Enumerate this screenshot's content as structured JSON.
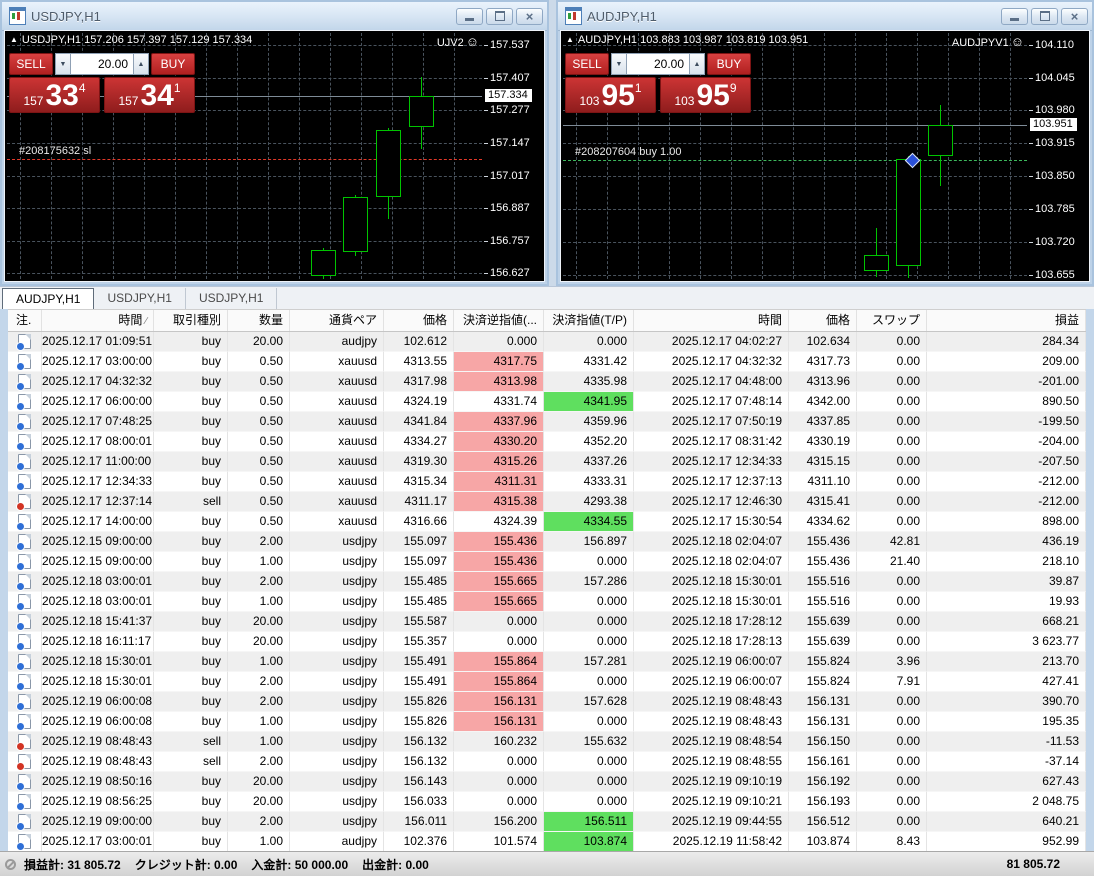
{
  "icons": {
    "triangle_up": "▲",
    "arrow_up": "▲",
    "arrow_down": "▼",
    "smiley": "☺",
    "close": "×",
    "sort_slash": "∕"
  },
  "charts": [
    {
      "window_title": "USDJPY,H1",
      "info_line": "USDJPY,H1 157.206 157.397 157.129 157.334",
      "ea_label": "UJV2",
      "trade_panel": {
        "sell_label": "SELL",
        "buy_label": "BUY",
        "volume": "20.00",
        "sell_price": {
          "small": "157",
          "big": "33",
          "sup": "4"
        },
        "buy_price": {
          "small": "157",
          "big": "34",
          "sup": "1"
        }
      },
      "order_line": {
        "label": "#208175632 sl",
        "price": 157.082,
        "color": "#e23a2a"
      },
      "chart_data": {
        "type": "candlestick",
        "symbol": "USDJPY",
        "timeframe": "H1",
        "ohlc": {
          "open": 157.206,
          "high": 157.397,
          "low": 157.129,
          "close": 157.334
        },
        "current_price": 157.334,
        "price_max": 157.585,
        "price_min": 156.605,
        "y_ticks": [
          157.537,
          157.407,
          157.277,
          157.147,
          157.017,
          156.887,
          156.757,
          156.627
        ],
        "candle_color": "#00c400",
        "bg": "#000000",
        "grid": true,
        "candles": [
          {
            "x": 316,
            "o": 156.615,
            "h": 156.728,
            "l": 156.585,
            "c": 156.722
          },
          {
            "x": 348,
            "o": 156.712,
            "h": 156.938,
            "l": 156.698,
            "c": 156.932
          },
          {
            "x": 381,
            "o": 156.932,
            "h": 157.205,
            "l": 156.842,
            "c": 157.198
          },
          {
            "x": 414,
            "o": 157.212,
            "h": 157.41,
            "l": 157.122,
            "c": 157.334
          }
        ]
      }
    },
    {
      "window_title": "AUDJPY,H1",
      "info_line": "AUDJPY,H1 103.883 103.987 103.819 103.951",
      "ea_label": "AUDJPYV1",
      "trade_panel": {
        "sell_label": "SELL",
        "buy_label": "BUY",
        "volume": "20.00",
        "sell_price": {
          "small": "103",
          "big": "95",
          "sup": "1"
        },
        "buy_price": {
          "small": "103",
          "big": "95",
          "sup": "9"
        }
      },
      "order_line": {
        "label": "#208207604 buy 1.00",
        "price": 103.883,
        "color": "#3cb85c"
      },
      "cursor": {
        "x": 349,
        "price": 103.883
      },
      "chart_data": {
        "type": "candlestick",
        "symbol": "AUDJPY",
        "timeframe": "H1",
        "ohlc": {
          "open": 103.883,
          "high": 103.987,
          "low": 103.819,
          "close": 103.951
        },
        "current_price": 103.951,
        "price_max": 104.133,
        "price_min": 103.647,
        "y_ticks": [
          104.11,
          104.045,
          103.98,
          103.915,
          103.85,
          103.785,
          103.72,
          103.655
        ],
        "candle_color": "#00c400",
        "bg": "#000000",
        "grid": true,
        "candles": [
          {
            "x": 313,
            "o": 103.662,
            "h": 103.748,
            "l": 103.65,
            "c": 103.695
          },
          {
            "x": 345,
            "o": 103.672,
            "h": 103.89,
            "l": 103.648,
            "c": 103.885
          },
          {
            "x": 377,
            "o": 103.89,
            "h": 103.99,
            "l": 103.83,
            "c": 103.951
          }
        ]
      }
    }
  ],
  "tabs": [
    {
      "label": "AUDJPY,H1",
      "active": true
    },
    {
      "label": "USDJPY,H1",
      "active": false
    },
    {
      "label": "USDJPY,H1",
      "active": false
    }
  ],
  "history": {
    "columns": [
      {
        "key": "icon",
        "label": "注."
      },
      {
        "key": "open_time",
        "label": "時間",
        "sort": "∕"
      },
      {
        "key": "type",
        "label": "取引種別"
      },
      {
        "key": "volume",
        "label": "数量"
      },
      {
        "key": "symbol",
        "label": "通貨ペア"
      },
      {
        "key": "open_price",
        "label": "価格"
      },
      {
        "key": "sl",
        "label": "決済逆指値(..."
      },
      {
        "key": "tp",
        "label": "決済指値(T/P)"
      },
      {
        "key": "close_time",
        "label": "時間"
      },
      {
        "key": "close_price",
        "label": "価格"
      },
      {
        "key": "swap",
        "label": "スワップ"
      },
      {
        "key": "profit",
        "label": "損益"
      }
    ],
    "rows": [
      {
        "type": "buy",
        "open_time": "2025.12.17 01:09:51",
        "volume": "20.00",
        "symbol": "audjpy",
        "open_price": "102.612",
        "sl": "0.000",
        "sl_hit": false,
        "tp": "0.000",
        "tp_hit": false,
        "close_time": "2025.12.17 04:02:27",
        "close_price": "102.634",
        "swap": "0.00",
        "profit": "284.34"
      },
      {
        "type": "buy",
        "open_time": "2025.12.17 03:00:00",
        "volume": "0.50",
        "symbol": "xauusd",
        "open_price": "4313.55",
        "sl": "4317.75",
        "sl_hit": true,
        "tp": "4331.42",
        "tp_hit": false,
        "close_time": "2025.12.17 04:32:32",
        "close_price": "4317.73",
        "swap": "0.00",
        "profit": "209.00"
      },
      {
        "type": "buy",
        "open_time": "2025.12.17 04:32:32",
        "volume": "0.50",
        "symbol": "xauusd",
        "open_price": "4317.98",
        "sl": "4313.98",
        "sl_hit": true,
        "tp": "4335.98",
        "tp_hit": false,
        "close_time": "2025.12.17 04:48:00",
        "close_price": "4313.96",
        "swap": "0.00",
        "profit": "-201.00"
      },
      {
        "type": "buy",
        "open_time": "2025.12.17 06:00:00",
        "volume": "0.50",
        "symbol": "xauusd",
        "open_price": "4324.19",
        "sl": "4331.74",
        "sl_hit": false,
        "tp": "4341.95",
        "tp_hit": true,
        "close_time": "2025.12.17 07:48:14",
        "close_price": "4342.00",
        "swap": "0.00",
        "profit": "890.50"
      },
      {
        "type": "buy",
        "open_time": "2025.12.17 07:48:25",
        "volume": "0.50",
        "symbol": "xauusd",
        "open_price": "4341.84",
        "sl": "4337.96",
        "sl_hit": true,
        "tp": "4359.96",
        "tp_hit": false,
        "close_time": "2025.12.17 07:50:19",
        "close_price": "4337.85",
        "swap": "0.00",
        "profit": "-199.50"
      },
      {
        "type": "buy",
        "open_time": "2025.12.17 08:00:01",
        "volume": "0.50",
        "symbol": "xauusd",
        "open_price": "4334.27",
        "sl": "4330.20",
        "sl_hit": true,
        "tp": "4352.20",
        "tp_hit": false,
        "close_time": "2025.12.17 08:31:42",
        "close_price": "4330.19",
        "swap": "0.00",
        "profit": "-204.00"
      },
      {
        "type": "buy",
        "open_time": "2025.12.17 11:00:00",
        "volume": "0.50",
        "symbol": "xauusd",
        "open_price": "4319.30",
        "sl": "4315.26",
        "sl_hit": true,
        "tp": "4337.26",
        "tp_hit": false,
        "close_time": "2025.12.17 12:34:33",
        "close_price": "4315.15",
        "swap": "0.00",
        "profit": "-207.50"
      },
      {
        "type": "buy",
        "open_time": "2025.12.17 12:34:33",
        "volume": "0.50",
        "symbol": "xauusd",
        "open_price": "4315.34",
        "sl": "4311.31",
        "sl_hit": true,
        "tp": "4333.31",
        "tp_hit": false,
        "close_time": "2025.12.17 12:37:13",
        "close_price": "4311.10",
        "swap": "0.00",
        "profit": "-212.00"
      },
      {
        "type": "sell",
        "open_time": "2025.12.17 12:37:14",
        "volume": "0.50",
        "symbol": "xauusd",
        "open_price": "4311.17",
        "sl": "4315.38",
        "sl_hit": true,
        "tp": "4293.38",
        "tp_hit": false,
        "close_time": "2025.12.17 12:46:30",
        "close_price": "4315.41",
        "swap": "0.00",
        "profit": "-212.00"
      },
      {
        "type": "buy",
        "open_time": "2025.12.17 14:00:00",
        "volume": "0.50",
        "symbol": "xauusd",
        "open_price": "4316.66",
        "sl": "4324.39",
        "sl_hit": false,
        "tp": "4334.55",
        "tp_hit": true,
        "close_time": "2025.12.17 15:30:54",
        "close_price": "4334.62",
        "swap": "0.00",
        "profit": "898.00"
      },
      {
        "type": "buy",
        "open_time": "2025.12.15 09:00:00",
        "volume": "2.00",
        "symbol": "usdjpy",
        "open_price": "155.097",
        "sl": "155.436",
        "sl_hit": true,
        "tp": "156.897",
        "tp_hit": false,
        "close_time": "2025.12.18 02:04:07",
        "close_price": "155.436",
        "swap": "42.81",
        "profit": "436.19"
      },
      {
        "type": "buy",
        "open_time": "2025.12.15 09:00:00",
        "volume": "1.00",
        "symbol": "usdjpy",
        "open_price": "155.097",
        "sl": "155.436",
        "sl_hit": true,
        "tp": "0.000",
        "tp_hit": false,
        "close_time": "2025.12.18 02:04:07",
        "close_price": "155.436",
        "swap": "21.40",
        "profit": "218.10"
      },
      {
        "type": "buy",
        "open_time": "2025.12.18 03:00:01",
        "volume": "2.00",
        "symbol": "usdjpy",
        "open_price": "155.485",
        "sl": "155.665",
        "sl_hit": true,
        "tp": "157.286",
        "tp_hit": false,
        "close_time": "2025.12.18 15:30:01",
        "close_price": "155.516",
        "swap": "0.00",
        "profit": "39.87"
      },
      {
        "type": "buy",
        "open_time": "2025.12.18 03:00:01",
        "volume": "1.00",
        "symbol": "usdjpy",
        "open_price": "155.485",
        "sl": "155.665",
        "sl_hit": true,
        "tp": "0.000",
        "tp_hit": false,
        "close_time": "2025.12.18 15:30:01",
        "close_price": "155.516",
        "swap": "0.00",
        "profit": "19.93"
      },
      {
        "type": "buy",
        "open_time": "2025.12.18 15:41:37",
        "volume": "20.00",
        "symbol": "usdjpy",
        "open_price": "155.587",
        "sl": "0.000",
        "sl_hit": false,
        "tp": "0.000",
        "tp_hit": false,
        "close_time": "2025.12.18 17:28:12",
        "close_price": "155.639",
        "swap": "0.00",
        "profit": "668.21"
      },
      {
        "type": "buy",
        "open_time": "2025.12.18 16:11:17",
        "volume": "20.00",
        "symbol": "usdjpy",
        "open_price": "155.357",
        "sl": "0.000",
        "sl_hit": false,
        "tp": "0.000",
        "tp_hit": false,
        "close_time": "2025.12.18 17:28:13",
        "close_price": "155.639",
        "swap": "0.00",
        "profit": "3 623.77"
      },
      {
        "type": "buy",
        "open_time": "2025.12.18 15:30:01",
        "volume": "1.00",
        "symbol": "usdjpy",
        "open_price": "155.491",
        "sl": "155.864",
        "sl_hit": true,
        "tp": "157.281",
        "tp_hit": false,
        "close_time": "2025.12.19 06:00:07",
        "close_price": "155.824",
        "swap": "3.96",
        "profit": "213.70"
      },
      {
        "type": "buy",
        "open_time": "2025.12.18 15:30:01",
        "volume": "2.00",
        "symbol": "usdjpy",
        "open_price": "155.491",
        "sl": "155.864",
        "sl_hit": true,
        "tp": "0.000",
        "tp_hit": false,
        "close_time": "2025.12.19 06:00:07",
        "close_price": "155.824",
        "swap": "7.91",
        "profit": "427.41"
      },
      {
        "type": "buy",
        "open_time": "2025.12.19 06:00:08",
        "volume": "2.00",
        "symbol": "usdjpy",
        "open_price": "155.826",
        "sl": "156.131",
        "sl_hit": true,
        "tp": "157.628",
        "tp_hit": false,
        "close_time": "2025.12.19 08:48:43",
        "close_price": "156.131",
        "swap": "0.00",
        "profit": "390.70"
      },
      {
        "type": "buy",
        "open_time": "2025.12.19 06:00:08",
        "volume": "1.00",
        "symbol": "usdjpy",
        "open_price": "155.826",
        "sl": "156.131",
        "sl_hit": true,
        "tp": "0.000",
        "tp_hit": false,
        "close_time": "2025.12.19 08:48:43",
        "close_price": "156.131",
        "swap": "0.00",
        "profit": "195.35"
      },
      {
        "type": "sell",
        "open_time": "2025.12.19 08:48:43",
        "volume": "1.00",
        "symbol": "usdjpy",
        "open_price": "156.132",
        "sl": "160.232",
        "sl_hit": false,
        "tp": "155.632",
        "tp_hit": false,
        "close_time": "2025.12.19 08:48:54",
        "close_price": "156.150",
        "swap": "0.00",
        "profit": "-11.53"
      },
      {
        "type": "sell",
        "open_time": "2025.12.19 08:48:43",
        "volume": "2.00",
        "symbol": "usdjpy",
        "open_price": "156.132",
        "sl": "0.000",
        "sl_hit": false,
        "tp": "0.000",
        "tp_hit": false,
        "close_time": "2025.12.19 08:48:55",
        "close_price": "156.161",
        "swap": "0.00",
        "profit": "-37.14"
      },
      {
        "type": "buy",
        "open_time": "2025.12.19 08:50:16",
        "volume": "20.00",
        "symbol": "usdjpy",
        "open_price": "156.143",
        "sl": "0.000",
        "sl_hit": false,
        "tp": "0.000",
        "tp_hit": false,
        "close_time": "2025.12.19 09:10:19",
        "close_price": "156.192",
        "swap": "0.00",
        "profit": "627.43"
      },
      {
        "type": "buy",
        "open_time": "2025.12.19 08:56:25",
        "volume": "20.00",
        "symbol": "usdjpy",
        "open_price": "156.033",
        "sl": "0.000",
        "sl_hit": false,
        "tp": "0.000",
        "tp_hit": false,
        "close_time": "2025.12.19 09:10:21",
        "close_price": "156.193",
        "swap": "0.00",
        "profit": "2 048.75"
      },
      {
        "type": "buy",
        "open_time": "2025.12.19 09:00:00",
        "volume": "2.00",
        "symbol": "usdjpy",
        "open_price": "156.011",
        "sl": "156.200",
        "sl_hit": false,
        "tp": "156.511",
        "tp_hit": true,
        "close_time": "2025.12.19 09:44:55",
        "close_price": "156.512",
        "swap": "0.00",
        "profit": "640.21"
      },
      {
        "type": "buy",
        "open_time": "2025.12.17 03:00:01",
        "volume": "1.00",
        "symbol": "audjpy",
        "open_price": "102.376",
        "sl": "101.574",
        "sl_hit": false,
        "tp": "103.874",
        "tp_hit": true,
        "close_time": "2025.12.19 11:58:42",
        "close_price": "103.874",
        "swap": "8.43",
        "profit": "952.99"
      }
    ]
  },
  "footer": {
    "totals": [
      "損益計: 31 805.72",
      "クレジット計: 0.00",
      "入金計: 50 000.00",
      "出金計: 0.00"
    ],
    "balance_total": "81 805.72"
  },
  "colors": {
    "sl_hit": "#f7a6a6",
    "tp_hit": "#5fdf5f",
    "grid": "#49535d",
    "candle": "#00c400",
    "sell_line": "#e23a2a",
    "buy_line": "#3cb85c"
  }
}
